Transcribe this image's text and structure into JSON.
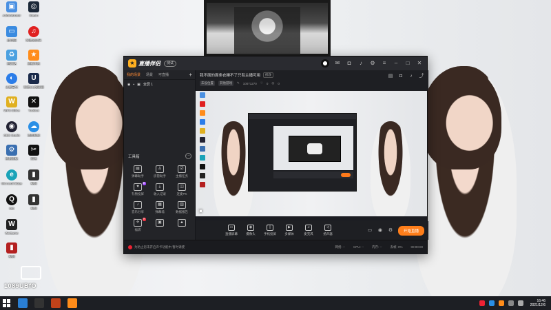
{
  "desktop": {
    "icons": [
      {
        "name": "Administrator",
        "color": "#4a90e2"
      },
      {
        "name": "Steam",
        "color": "#1b2838"
      },
      {
        "name": "此电脑",
        "color": "#3a8be0"
      },
      {
        "name": "网易云音乐",
        "color": "#e02020"
      },
      {
        "name": "回收站",
        "color": "#4aa0e0"
      },
      {
        "name": "直播伴侣",
        "color": "#ff8c1a"
      },
      {
        "name": "火绒安全",
        "color": "#2b7de9"
      },
      {
        "name": "网易UU加速器",
        "color": "#1a2a4a"
      },
      {
        "name": "WPS Office",
        "color": "#e0b020"
      },
      {
        "name": "Toolbox",
        "color": "#111111"
      },
      {
        "name": "OBS Studio",
        "color": "#222233"
      },
      {
        "name": "百度网盘",
        "color": "#2a8fe6"
      },
      {
        "name": "控制面板",
        "color": "#3a6fb0"
      },
      {
        "name": "剪映",
        "color": "#111111"
      },
      {
        "name": "Microsoft Edge",
        "color": "#1aa3b8"
      },
      {
        "name": "视频",
        "color": "#333333"
      },
      {
        "name": "QQ",
        "color": "#111111"
      },
      {
        "name": "视频",
        "color": "#333333"
      },
      {
        "name": "WeGame",
        "color": "#222222"
      },
      {
        "name": "视频",
        "color": "#b42020"
      }
    ]
  },
  "watermark": {
    "text": "1089UBfO"
  },
  "app": {
    "name": "直播伴侣",
    "version_badge": "测试",
    "left_tabs": [
      "我的场景",
      "场景",
      "可直播"
    ],
    "scene": {
      "label": "全屏 1"
    },
    "tools_heading": "工具箱",
    "tools": [
      {
        "label": "弹幕助手",
        "glyph": "▤",
        "badge": ""
      },
      {
        "label": "房管助手",
        "glyph": "♙",
        "badge": ""
      },
      {
        "label": "主播任务",
        "glyph": "☑",
        "badge": ""
      },
      {
        "label": "礼物投屏",
        "glyph": "♥",
        "badge": "新"
      },
      {
        "label": "收入记录",
        "glyph": "⤓",
        "badge": ""
      },
      {
        "label": "连麦PK",
        "glyph": "◫",
        "badge": ""
      },
      {
        "label": "音乐分享",
        "glyph": "♪",
        "badge": ""
      },
      {
        "label": "弹幕墙",
        "glyph": "▦",
        "badge": ""
      },
      {
        "label": "数据报告",
        "glyph": "▥",
        "badge": ""
      },
      {
        "label": "福袋",
        "glyph": "✈",
        "badge": "热"
      },
      {
        "label": "",
        "glyph": "▣",
        "badge": ""
      },
      {
        "label": "",
        "glyph": "▲",
        "badge": ""
      }
    ],
    "preview": {
      "title": "我不面的面条衣睡不了只有主播可用",
      "edit_label": "修改",
      "meta": [
        "未设位置",
        "其他游戏",
        "10071270",
        "0",
        "0"
      ]
    },
    "controls": [
      {
        "label": "直播屏幕",
        "glyph": "▭"
      },
      {
        "label": "摄像头",
        "glyph": "◉"
      },
      {
        "label": "手机投屏",
        "glyph": "▯"
      },
      {
        "label": "多媒体",
        "glyph": "▶"
      },
      {
        "label": "麦克风",
        "glyph": "♫"
      },
      {
        "label": "扬声器",
        "glyph": "◁"
      }
    ],
    "live_button": "开始直播",
    "status": {
      "notice": "为防止您未开启声卡功能中,暂时请使",
      "stats": [
        "网络: --",
        "CPU: --",
        "内存: --",
        "丢帧: 0%",
        "00:00:00"
      ]
    }
  },
  "taskbar": {
    "apps": [
      {
        "name": "edge",
        "color": "#2a7fd4"
      },
      {
        "name": "obs",
        "color": "#333333"
      },
      {
        "name": "live",
        "color": "#c0421a"
      },
      {
        "name": "companion",
        "color": "#ff8c1a"
      }
    ],
    "time": "16:46",
    "date": "2021/12/6"
  }
}
